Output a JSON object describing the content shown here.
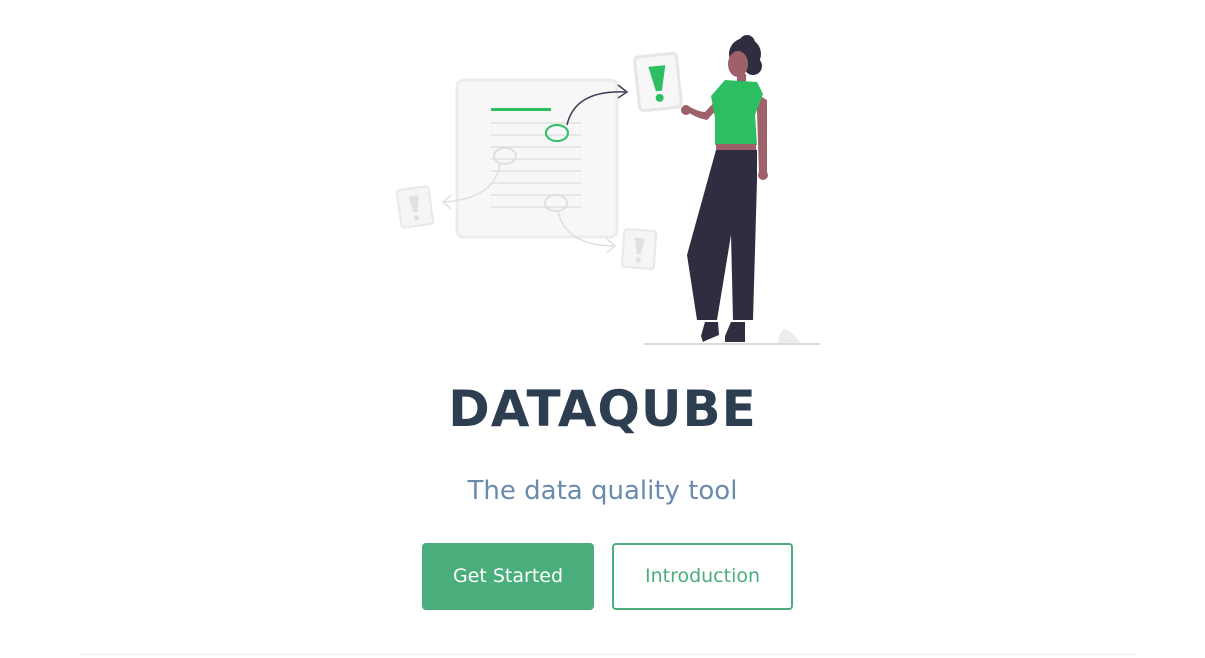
{
  "hero": {
    "title": "DATAQUBE",
    "tagline": "The data quality tool",
    "actions": {
      "primary_label": "Get Started",
      "secondary_label": "Introduction"
    }
  },
  "colors": {
    "accent": "#4aad7c",
    "title": "#2c3e50",
    "tagline": "#6a8bad",
    "illustration_green": "#2cbf62",
    "illustration_dark": "#2f2e41",
    "illustration_skin": "#9e616a",
    "illustration_light": "#f0f0f0"
  },
  "illustration": {
    "name": "person-holding-alert-card"
  }
}
